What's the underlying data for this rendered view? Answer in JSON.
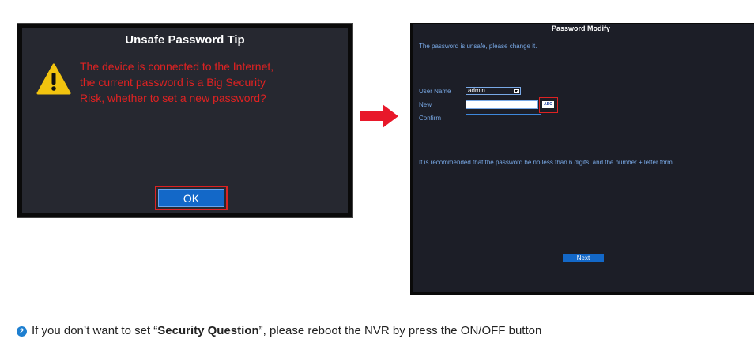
{
  "tip_dialog": {
    "title": "Unsafe Password Tip",
    "message_lines": [
      "The device is connected to the Internet,",
      "the current password is a Big Security",
      "Risk, whether to set a new password?"
    ],
    "ok_label": "OK",
    "icon": "warning-triangle-icon"
  },
  "arrow_icon": "right-arrow-icon",
  "modify_dialog": {
    "title": "Password Modify",
    "unsafe_text": "The password is unsafe, please change it.",
    "user_name_label": "User Name",
    "user_name_value": "admin",
    "new_label": "New",
    "new_value": "",
    "abc_label": "ABC",
    "confirm_label": "Confirm",
    "confirm_value": "",
    "recommend_text": "It is recommended that the password be no less than 6 digits, and the number + letter form",
    "next_label": "Next"
  },
  "bottom_note": {
    "step": "2",
    "prefix": "If you don’t want to set “",
    "bold": "Security Question",
    "suffix": "”, please reboot the NVR by press the ON/OFF button"
  },
  "colors": {
    "accent_red": "#e02222",
    "button_blue": "#1368c8",
    "label_blue": "#79a9e6"
  }
}
